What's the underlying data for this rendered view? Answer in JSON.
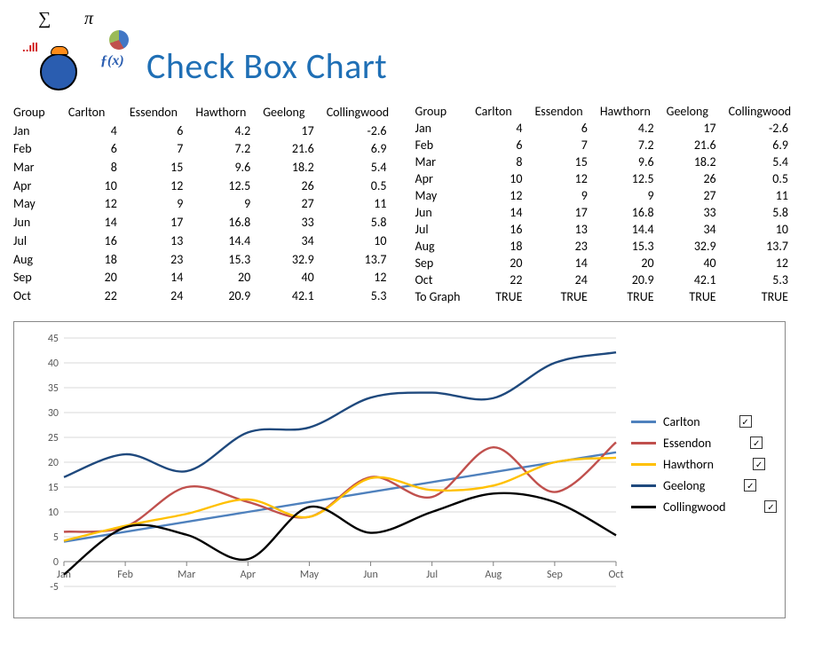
{
  "title": "Check Box Chart",
  "symbols": {
    "sigma": "∑",
    "pi": "π",
    "fx": "ƒ(x)",
    "bars": "..ıll"
  },
  "columns": [
    "Group",
    "Carlton",
    "Essendon",
    "Hawthorn",
    "Geelong",
    "Collingwood"
  ],
  "months": [
    "Jan",
    "Feb",
    "Mar",
    "Apr",
    "May",
    "Jun",
    "Jul",
    "Aug",
    "Sep",
    "Oct"
  ],
  "table": {
    "Jan": {
      "Carlton": 4,
      "Essendon": 6,
      "Hawthorn": 4.2,
      "Geelong": 17,
      "Collingwood": -2.6
    },
    "Feb": {
      "Carlton": 6,
      "Essendon": 7,
      "Hawthorn": 7.2,
      "Geelong": 21.6,
      "Collingwood": 6.9
    },
    "Mar": {
      "Carlton": 8,
      "Essendon": 15,
      "Hawthorn": 9.6,
      "Geelong": 18.2,
      "Collingwood": 5.4
    },
    "Apr": {
      "Carlton": 10,
      "Essendon": 12,
      "Hawthorn": 12.5,
      "Geelong": 26,
      "Collingwood": 0.5
    },
    "May": {
      "Carlton": 12,
      "Essendon": 9,
      "Hawthorn": 9,
      "Geelong": 27,
      "Collingwood": 11
    },
    "Jun": {
      "Carlton": 14,
      "Essendon": 17,
      "Hawthorn": 16.8,
      "Geelong": 33,
      "Collingwood": 5.8
    },
    "Jul": {
      "Carlton": 16,
      "Essendon": 13,
      "Hawthorn": 14.4,
      "Geelong": 34,
      "Collingwood": 10
    },
    "Aug": {
      "Carlton": 18,
      "Essendon": 23,
      "Hawthorn": 15.3,
      "Geelong": 32.9,
      "Collingwood": 13.7
    },
    "Sep": {
      "Carlton": 20,
      "Essendon": 14,
      "Hawthorn": 20,
      "Geelong": 40,
      "Collingwood": 12
    },
    "Oct": {
      "Carlton": 22,
      "Essendon": 24,
      "Hawthorn": 20.9,
      "Geelong": 42.1,
      "Collingwood": 5.3
    }
  },
  "to_graph_label": "To Graph",
  "to_graph": {
    "Carlton": "TRUE",
    "Essendon": "TRUE",
    "Hawthorn": "TRUE",
    "Geelong": "TRUE",
    "Collingwood": "TRUE"
  },
  "legend_check": "✓",
  "series_colors": {
    "Carlton": "#4f81bd",
    "Essendon": "#c0504d",
    "Hawthorn": "#ffc000",
    "Geelong": "#1f497d",
    "Collingwood": "#000000"
  },
  "chart_data": {
    "type": "line",
    "categories": [
      "Jan",
      "Feb",
      "Mar",
      "Apr",
      "May",
      "Jun",
      "Jul",
      "Aug",
      "Sep",
      "Oct"
    ],
    "series": [
      {
        "name": "Carlton",
        "values": [
          4,
          6,
          8,
          10,
          12,
          14,
          16,
          18,
          20,
          22
        ],
        "color": "#4f81bd"
      },
      {
        "name": "Essendon",
        "values": [
          6,
          7,
          15,
          12,
          9,
          17,
          13,
          23,
          14,
          24
        ],
        "color": "#c0504d"
      },
      {
        "name": "Hawthorn",
        "values": [
          4.2,
          7.2,
          9.6,
          12.5,
          9,
          16.8,
          14.4,
          15.3,
          20,
          20.9
        ],
        "color": "#ffc000"
      },
      {
        "name": "Geelong",
        "values": [
          17,
          21.6,
          18.2,
          26,
          27,
          33,
          34,
          32.9,
          40,
          42.1
        ],
        "color": "#1f497d"
      },
      {
        "name": "Collingwood",
        "values": [
          -2.6,
          6.9,
          5.4,
          0.5,
          11,
          5.8,
          10,
          13.7,
          12,
          5.3
        ],
        "color": "#000000"
      }
    ],
    "ylim": [
      -5,
      45
    ],
    "yticks": [
      -5,
      0,
      5,
      10,
      15,
      20,
      25,
      30,
      35,
      40,
      45
    ],
    "xlabel": "",
    "ylabel": "",
    "title": ""
  }
}
